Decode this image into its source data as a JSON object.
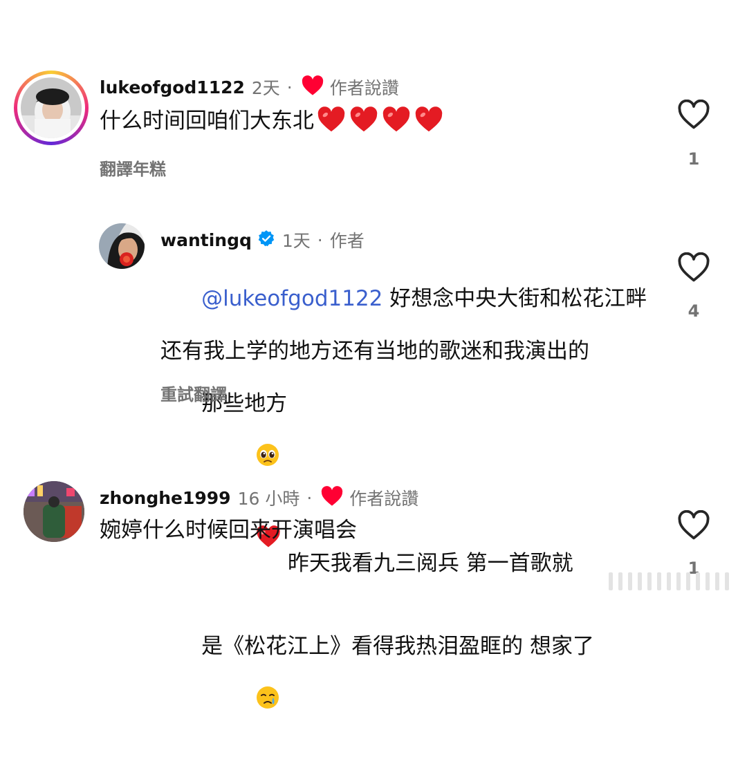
{
  "comments": [
    {
      "username": "lukeofgod1122",
      "time": "2天",
      "author_liked_label": "作者說讚",
      "text": "什么时间回咱们大东北",
      "heart_emojis": [
        "heart",
        "heart",
        "heart",
        "heart"
      ],
      "action": "翻譯年糕",
      "like_count": "1"
    },
    {
      "username": "wantingq",
      "verified": true,
      "time": "1天",
      "author_label": "作者",
      "mention": "@lukeofgod1122",
      "line1_rest": " 好想念中央大街和松花江畔",
      "line2": "还有我上学的地方还有当地的歌迷和我演出的",
      "line3_start": "那些地方",
      "line3_end": " 昨天我看九三阅兵 第一首歌就",
      "line4_start": "是《松花江上》看得我热泪盈眶的 想家了",
      "action": "重試翻譯",
      "like_count": "4"
    },
    {
      "username": "zhonghe1999",
      "time": "16 小時",
      "author_liked_label": "作者說讚",
      "text": "婉婷什么时候回来开演唱会",
      "like_count": "1"
    }
  ],
  "separator": "·",
  "colors": {
    "heart_red": "#ff0033",
    "mention_blue": "#3a5fcd",
    "verified_blue": "#0095f6",
    "meta_gray": "#737373"
  },
  "icons": [
    "heart-outline-icon",
    "red-heart-icon",
    "verified-badge-icon",
    "pleading-face-emoji",
    "crying-face-emoji"
  ]
}
